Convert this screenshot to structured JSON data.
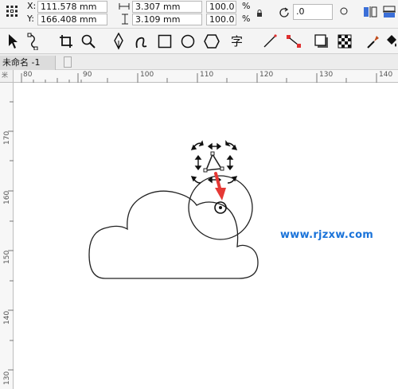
{
  "property_bar": {
    "x_label": "X:",
    "x_value": "111.578 mm",
    "y_label": "Y:",
    "y_value": "166.408 mm",
    "width_value": "3.307 mm",
    "height_value": "3.109 mm",
    "scale_w": "100.0",
    "scale_h": "100.0",
    "percent_1": "%",
    "percent_2": "%",
    "rotation_value": ".0"
  },
  "document_tab": {
    "title": "未命名 -1"
  },
  "rulers": {
    "horizontal_labels": [
      "80",
      "90",
      "100",
      "110",
      "120",
      "130",
      "140"
    ],
    "vertical_labels": [
      "170",
      "160",
      "150",
      "140",
      "130"
    ],
    "unit_glyph": "米"
  },
  "watermark": {
    "text": "www.rjzxw.com"
  },
  "toolbar": {
    "text_tool_glyph": "字"
  },
  "colors": {
    "accent_arrow": "#e53935",
    "watermark": "#1a73d9"
  }
}
